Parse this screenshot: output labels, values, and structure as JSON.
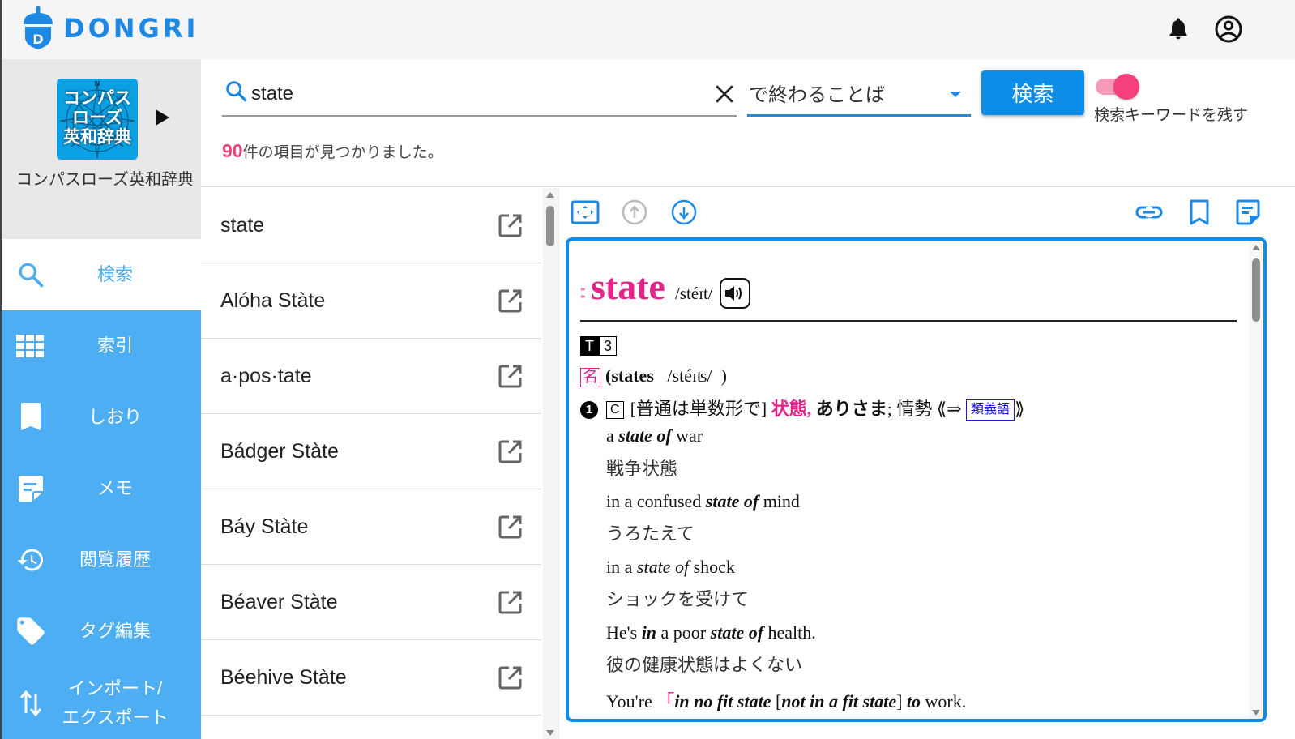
{
  "app": {
    "brand": "DONGRI",
    "colors": {
      "accent": "#1e88e5",
      "sidebar": "#4daef3",
      "pink": "#e3248a",
      "toggle": "#f5407c"
    }
  },
  "header": {
    "icons": [
      "bell-icon",
      "account-circle-icon"
    ]
  },
  "dictionary": {
    "logo_lines": [
      "コンパス",
      "ローズ",
      "英和辞典"
    ],
    "name": "コンパスローズ英和辞典"
  },
  "sidebar": {
    "items": [
      {
        "label": "検索",
        "icon": "search-icon",
        "active": true
      },
      {
        "label": "索引",
        "icon": "grid-icon",
        "active": false
      },
      {
        "label": "しおり",
        "icon": "bookmark-icon",
        "active": false
      },
      {
        "label": "メモ",
        "icon": "note-icon",
        "active": false
      },
      {
        "label": "閲覧履歴",
        "icon": "history-icon",
        "active": false
      },
      {
        "label": "タグ編集",
        "icon": "tag-icon",
        "active": false
      },
      {
        "label_line1": "インポート/",
        "label_line2": "エクスポート",
        "icon": "import-export-icon",
        "active": false
      }
    ]
  },
  "search": {
    "query": "state",
    "mode": "で終わることば",
    "button_label": "検索",
    "keep_keyword_label": "検索キーワードを残す",
    "keep_keyword_on": true,
    "result_count": "90",
    "result_suffix": "件の項目が見つかりました。"
  },
  "results": [
    {
      "word": "state"
    },
    {
      "word": "Alóha Stàte"
    },
    {
      "word": "a·pos·tate"
    },
    {
      "word": "Bádger Stàte"
    },
    {
      "word": "Báy Stàte"
    },
    {
      "word": "Béaver Stàte"
    },
    {
      "word": "Béehive Stàte"
    }
  ],
  "detail": {
    "toolbar": [
      "fit-screen-icon",
      "arrow-up-circle-icon",
      "arrow-down-circle-icon",
      "link-icon",
      "bookmark-outline-icon",
      "note-icon"
    ],
    "stars": "**",
    "headword": "state",
    "pronunciation": "/stéɪt/",
    "level_badge": "T",
    "level_number": "3",
    "pos": "名",
    "plural_word": "states",
    "plural_pron": "/stéɪʦ/",
    "sense_number": "1",
    "countability": "C",
    "usage_note": "[普通は単数形で]",
    "meaning_main": "状態,",
    "meaning_bold": "ありさま",
    "meaning_rest": "; 情勢",
    "ref_open": "⟪⇒",
    "ref_label": "類義語",
    "ref_close": "⟫",
    "examples": [
      {
        "pre": "a ",
        "bi": "state of",
        "post": " war",
        "ja": "戦争状態"
      },
      {
        "pre": "in a confused ",
        "bi": "state of",
        "post": " mind",
        "ja": "うろたえて"
      },
      {
        "pre": "in a ",
        "i": "state of",
        "post": " shock",
        "ja": "ショックを受けて"
      },
      {
        "pre": "He's ",
        "bi1": "in",
        "mid": " a poor ",
        "bi": "state of",
        "post": " health.",
        "ja": "彼の健康状態はよくない"
      },
      {
        "pre": "You're ",
        "bracket": "「",
        "bi1": "in no fit state",
        "mid": " [",
        "bi2": "not in a fit state",
        "mid2": "] ",
        "bi3": "to",
        "post": " work."
      }
    ]
  }
}
